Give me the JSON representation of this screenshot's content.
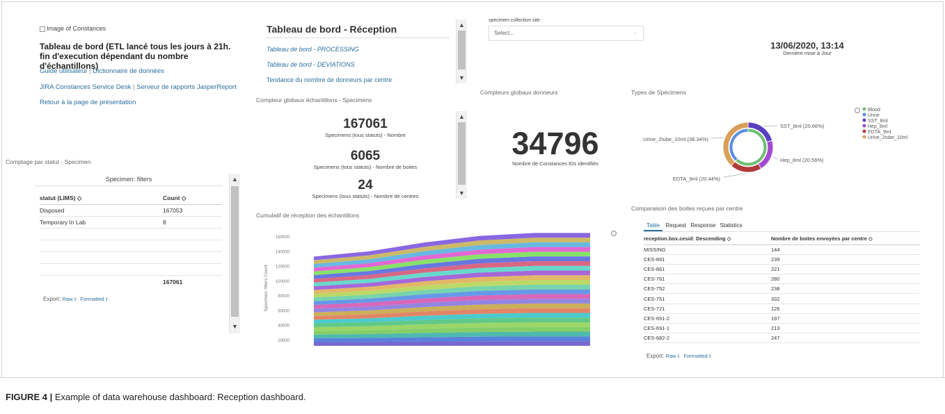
{
  "sidebar": {
    "image_alt": "Image of Constances",
    "title": "Tableau de bord (ETL lancé tous les jours à 21h. fin d'execution dépendant du nombre d'échantillons)",
    "links_row1": [
      "Guide utilisateur",
      "Dictionnaire de données"
    ],
    "links_row2": [
      "JIRA Constances Service Desk",
      "Serveur de rapports JasperReport"
    ],
    "links_row3": "Retour à la page de présentation",
    "separator": "|"
  },
  "status_panel": {
    "title": "Comptage par statut - Specimen",
    "filter_header": "Specimen: filters",
    "columns": [
      "statut (LIMS) ◇",
      "Count ◇"
    ],
    "rows": [
      [
        "Disposed",
        "167053"
      ],
      [
        "Temporary In Lab",
        "8"
      ]
    ],
    "total": "167061",
    "export_label": "Export:",
    "export_raw": "Raw",
    "export_formatted": "Formatted"
  },
  "nav_panel": {
    "title": "Tableau de bord - Réception",
    "links": [
      "Tableau de bord - PROCESSING",
      "Tableau de bord - DEVIATIONS",
      "Tendance du nombre de donneurs par centre"
    ]
  },
  "counters": {
    "title": "Compteur globaux échantillons - Specimens",
    "items": [
      {
        "value": "167061",
        "label": "Specimens (tous statuts) - Nombre"
      },
      {
        "value": "6065",
        "label": "Specimens (tous statuts) - Nombre de boites"
      },
      {
        "value": "24",
        "label": "Specimens (tous statuts) - Nombre de centres"
      }
    ]
  },
  "filter": {
    "label": "specimen collection site",
    "placeholder": "Select..."
  },
  "donors": {
    "title": "Compteurs globaux donneurs",
    "value": "34796",
    "label": "Nombre de Constances IDs identifiés"
  },
  "update": {
    "datetime": "13/06/2020, 13:14",
    "label": "Dernière mise à Jour"
  },
  "types_title": "Types de Spécimens",
  "boxes": {
    "title": "Comparaison des boites reçues par centre",
    "tabs": [
      "Table",
      "Request",
      "Response",
      "Statistics"
    ],
    "columns": [
      "reception.box.cesid: Descending ◇",
      "Nombre de boites envoyées par centre ◇"
    ],
    "rows": [
      [
        "MISSING",
        "144"
      ],
      [
        "CES-891",
        "239"
      ],
      [
        "CES-861",
        "221"
      ],
      [
        "CES-761",
        "280"
      ],
      [
        "CES-752",
        "238"
      ],
      [
        "CES-751",
        "332"
      ],
      [
        "CES-721",
        "126"
      ],
      [
        "CES-691-2",
        "197"
      ],
      [
        "CES-691-1",
        "213"
      ],
      [
        "CES-682-2",
        "247"
      ]
    ],
    "export_label": "Export:",
    "export_raw": "Raw",
    "export_formatted": "Formatted"
  },
  "area_title": "Cumulatif de réception des échantillons",
  "caption": {
    "label": "FIGURE 4 |",
    "text": "Example of data warehouse dashboard: Reception dashboard."
  },
  "colors": {
    "link": "#2a6fa0",
    "blood": "#6fbf73",
    "urine": "#5b8fe0",
    "sst": "#5b3fc0",
    "hep": "#a24ad0",
    "edta": "#b03a3a",
    "urine2": "#d9a05a"
  },
  "chart_data": [
    {
      "type": "pie",
      "title": "",
      "labels": [
        "Blood",
        "Urine",
        "SST_8ml",
        "Hep_8ml",
        "EDTA_9ml",
        "Urine_2tube_10ml"
      ],
      "outer_ring": [
        {
          "label": "SST_8ml (20.66%)",
          "value": 20.66
        },
        {
          "label": "Hep_8ml (20.56%)",
          "value": 20.56
        },
        {
          "label": "EDTA_9ml (20.44%)",
          "value": 20.44
        },
        {
          "label": "Urine_2tube_10ml (38.34%)",
          "value": 38.34
        }
      ],
      "inner_ring": [
        {
          "label": "Blood",
          "value": 61.66
        },
        {
          "label": "Urine",
          "value": 38.34
        }
      ],
      "legend_position": "top-right"
    },
    {
      "type": "area",
      "title": "",
      "ylabel": "Specimen: filters Count",
      "yticks": [
        20000,
        40000,
        60000,
        80000,
        100000,
        120000,
        140000,
        160000
      ],
      "ylim": [
        10000,
        170000
      ],
      "x": [
        0,
        1,
        2,
        3,
        4,
        5
      ],
      "total_values": [
        133000,
        140000,
        152000,
        161000,
        165000,
        165000
      ],
      "num_series": 24,
      "stacked": true
    }
  ]
}
